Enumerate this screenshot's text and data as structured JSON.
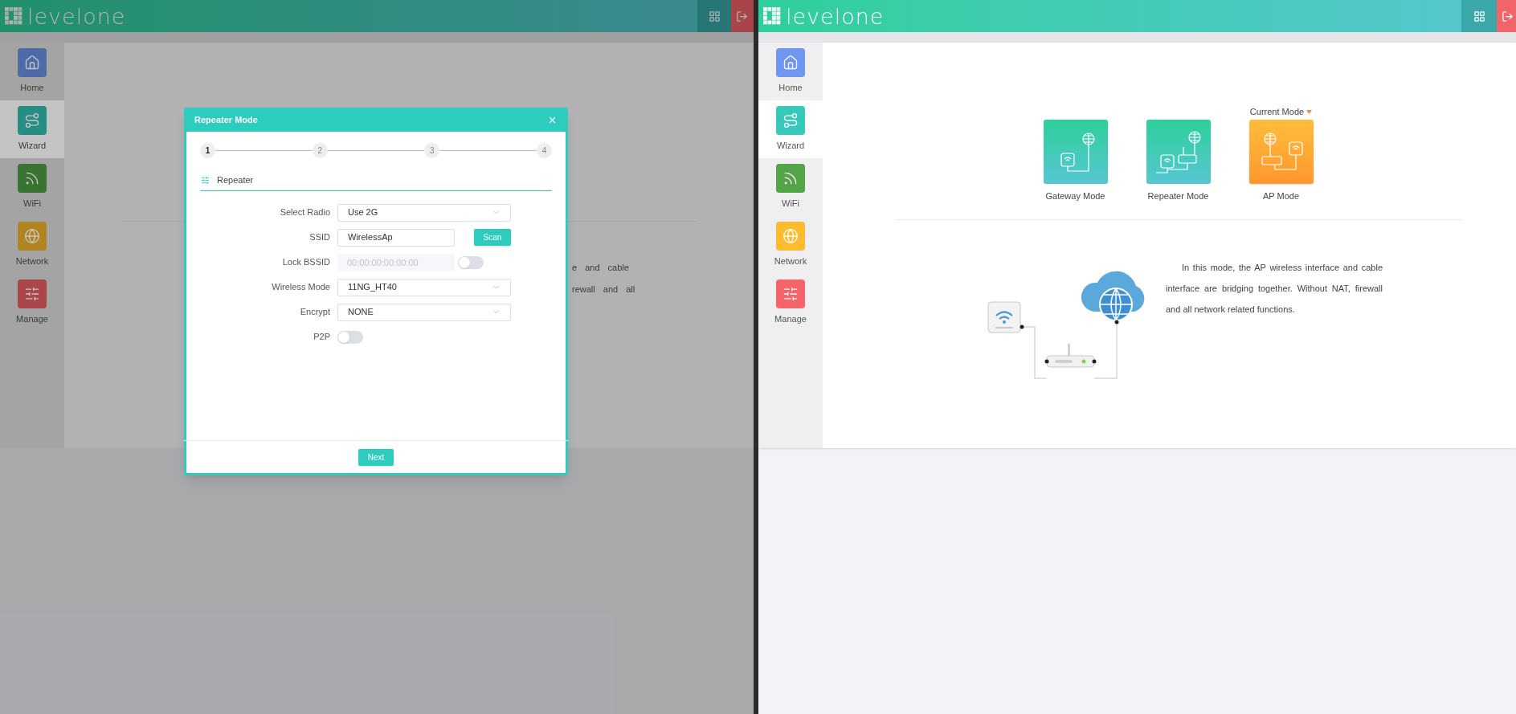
{
  "left_pane": {
    "header": {
      "logo": "levelone"
    },
    "sidebar": [
      {
        "label": "Home",
        "color": "#4e6aa7",
        "selected": false
      },
      {
        "label": "Wizard",
        "color": "#268d82",
        "selected": true
      },
      {
        "label": "WiFi",
        "color": "#397332",
        "selected": false
      },
      {
        "label": "Network",
        "color": "#b08421",
        "selected": false
      },
      {
        "label": "Manage",
        "color": "#ab464b",
        "selected": false
      }
    ],
    "background_text": [
      "e and cable",
      "rewall and all"
    ],
    "dialog": {
      "title": "Repeater Mode",
      "steps": [
        {
          "label": "1",
          "selected": true
        },
        {
          "label": "2",
          "selected": false
        },
        {
          "label": "3",
          "selected": false
        },
        {
          "label": "4",
          "selected": false
        }
      ],
      "section": "Repeater",
      "fields": [
        {
          "kind": "select",
          "label": "Select Radio",
          "value": "Use 2G"
        },
        {
          "kind": "text_button",
          "label": "SSID",
          "value": "WirelessAp",
          "button": "Scan"
        },
        {
          "kind": "text_toggle",
          "label": "Lock BSSID",
          "placeholder": "00:00:00:00:00:00",
          "disabled": true,
          "on": false
        },
        {
          "kind": "select",
          "label": "Wireless Mode",
          "value": "11NG_HT40"
        },
        {
          "kind": "select",
          "label": "Encrypt",
          "value": "NONE"
        },
        {
          "kind": "toggle",
          "label": "P2P",
          "on": false
        }
      ],
      "next_button": "Next"
    }
  },
  "right_pane": {
    "header": {
      "logo": "levelone"
    },
    "sidebar": [
      {
        "label": "Home",
        "color": "#6f97ee",
        "selected": false
      },
      {
        "label": "Wizard",
        "color": "#36c9b9",
        "selected": true
      },
      {
        "label": "WiFi",
        "color": "#52a447",
        "selected": false
      },
      {
        "label": "Network",
        "color": "#fbbd2f",
        "selected": false
      },
      {
        "label": "Manage",
        "color": "#f4646b",
        "selected": false
      }
    ],
    "current_mode_label": "Current Mode",
    "modes": [
      {
        "label": "Gateway Mode",
        "kind": "gateway",
        "current": false
      },
      {
        "label": "Repeater Mode",
        "kind": "repeater",
        "current": false
      },
      {
        "label": "AP Mode",
        "kind": "ap",
        "current": true
      }
    ],
    "description": "In this mode, the AP wireless interface and cable interface are bridging together. Without NAT, firewall and all network related functions."
  }
}
